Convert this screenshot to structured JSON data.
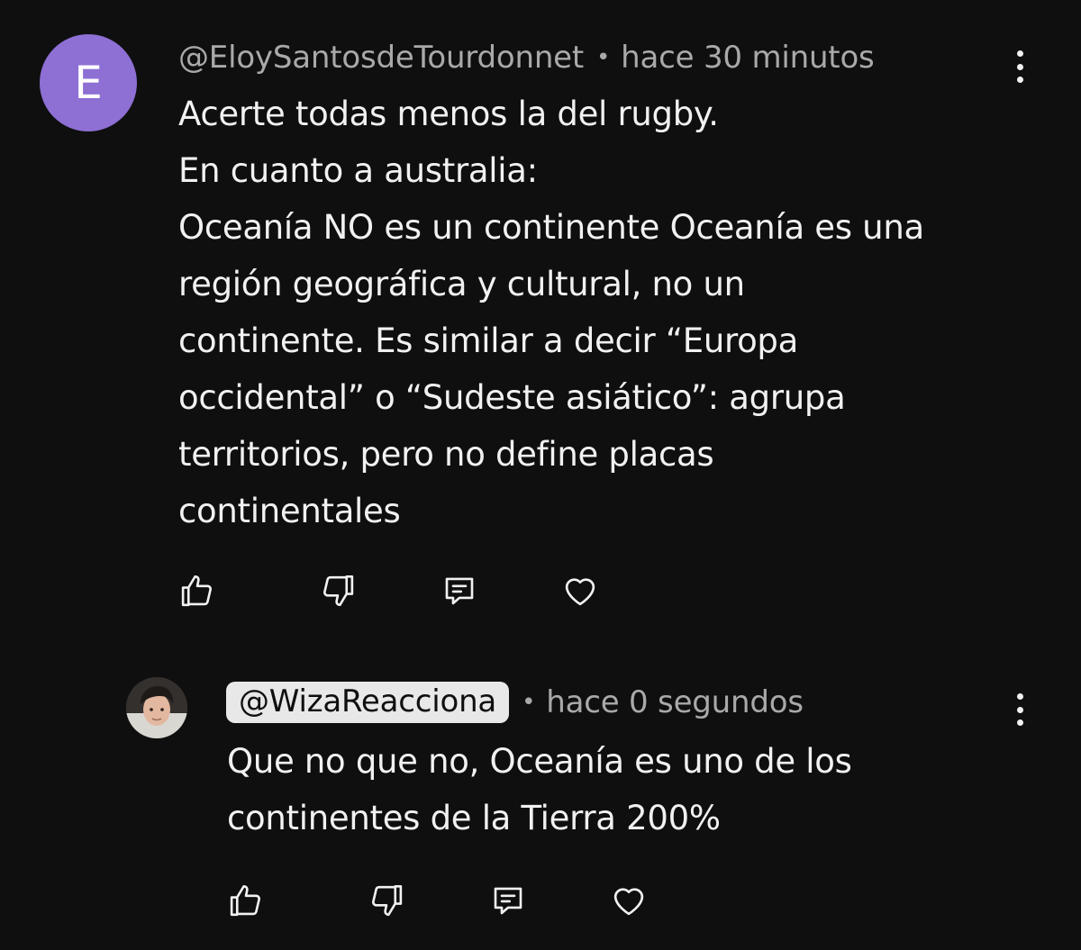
{
  "comment": {
    "avatar_letter": "E",
    "avatar_color": "#8e6fd4",
    "author": "@EloySantosdeTourdonnet",
    "separator": "•",
    "timestamp": "hace 30 minutos",
    "lines": [
      "Acerte todas menos la del rugby.",
      "En cuanto a australia:",
      "Oceanía NO es un continente Oceanía es una",
      "región geográfica y cultural, no un",
      "continente. Es similar a decir “Europa",
      "occidental” o “Sudeste asiático”: agrupa",
      "territorios, pero no define placas",
      "continentales"
    ],
    "actions": [
      "thumbs-up-icon",
      "thumbs-down-icon",
      "reply-icon",
      "heart-icon"
    ]
  },
  "reply": {
    "author": "@WizaReacciona",
    "separator": "•",
    "timestamp": "hace 0 segundos",
    "lines": [
      "Que no que no, Oceanía es uno de los",
      "continentes de la Tierra 200%"
    ],
    "actions": [
      "thumbs-up-icon",
      "thumbs-down-icon",
      "reply-icon",
      "heart-icon"
    ]
  },
  "colors": {
    "background": "#0f0f0f",
    "text": "#f1f1f1",
    "meta": "#a9a9a9",
    "chip": "#e8e8e8"
  }
}
